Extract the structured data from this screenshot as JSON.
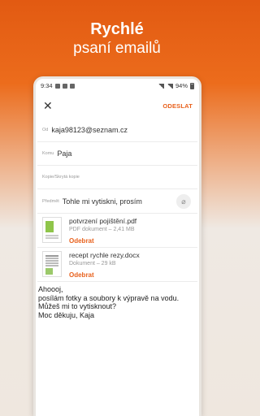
{
  "promo": {
    "title": "Rychlé",
    "subtitle": "psaní emailů"
  },
  "statusbar": {
    "time": "9:34",
    "battery": "94%",
    "icons": [
      "notification-icon",
      "image-icon",
      "mail-icon",
      "dot-icon",
      "wifi-icon",
      "signal-icon",
      "battery-icon"
    ]
  },
  "toolbar": {
    "close_icon": "close-icon",
    "send_label": "ODESLAT"
  },
  "form": {
    "from_label": "Od",
    "from_value": "kaja98123@seznam.cz",
    "to_label": "Komu",
    "to_value": "Paja",
    "cc_label": "Kopie/Skrytá kopie",
    "subject_label": "Předmět",
    "subject_value": "Tohle mi vytiskni, prosím"
  },
  "attachments": [
    {
      "name": "potvrzení pojištění.pdf",
      "meta": "PDF dokument – 2,41 MB",
      "remove": "Odebrat"
    },
    {
      "name": "recept rychle rezy.docx",
      "meta": "Dokument – 29 kB",
      "remove": "Odebrat"
    }
  ],
  "body": "Ahoooj,\nposílám fotky a soubory k výpravě na vodu.\nMůžeš mi to vytisknout?\nMoc děkuju, Kaja",
  "colors": {
    "accent": "#e8611d",
    "background_top": "#e25a12"
  }
}
